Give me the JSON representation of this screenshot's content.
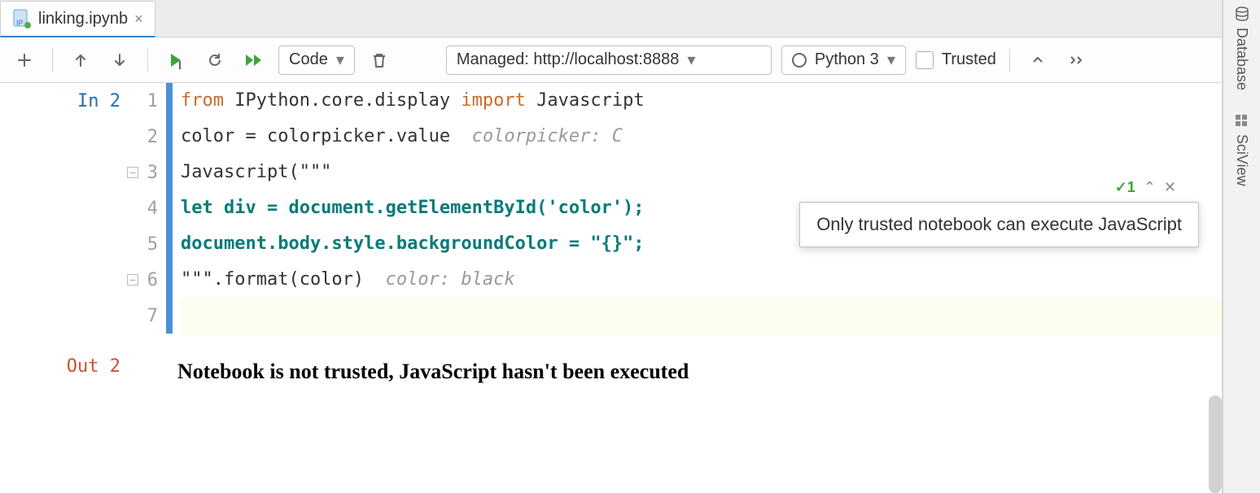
{
  "tab": {
    "filename": "linking.ipynb",
    "close_glyph": "×"
  },
  "toolbar": {
    "celltype": "Code",
    "server": "Managed: http://localhost:8888",
    "kernel": "Python 3",
    "trusted_label": "Trusted"
  },
  "cell": {
    "in_prompt": "In 2",
    "out_prompt": "Out 2",
    "line_numbers": [
      "1",
      "2",
      "3",
      "4",
      "5",
      "6",
      "7"
    ],
    "code": {
      "l1": {
        "kw_from": "from",
        "mod": " IPython.core.display ",
        "kw_import": "import",
        "name": " Javascript"
      },
      "l2": {
        "text": "color = colorpicker.value  ",
        "hint": "colorpicker: C"
      },
      "l3": {
        "text": "Javascript(\"\"\""
      },
      "l4": {
        "text": "let div = document.getElementById('color');"
      },
      "l5": {
        "text": "document.body.style.backgroundColor = \"{}\";"
      },
      "l6": {
        "text": "\"\"\".format(color)  ",
        "hint": "color: black"
      },
      "l7": {
        "text": ""
      }
    },
    "output_text": "Notebook is not trusted, JavaScript hasn't been executed"
  },
  "cell_status": {
    "badge": "✓1",
    "up": "⌃",
    "close": "✕"
  },
  "tooltip": {
    "text": "Only trusted notebook can execute JavaScript"
  },
  "side_rail": {
    "db": "Database",
    "sci": "SciView"
  }
}
